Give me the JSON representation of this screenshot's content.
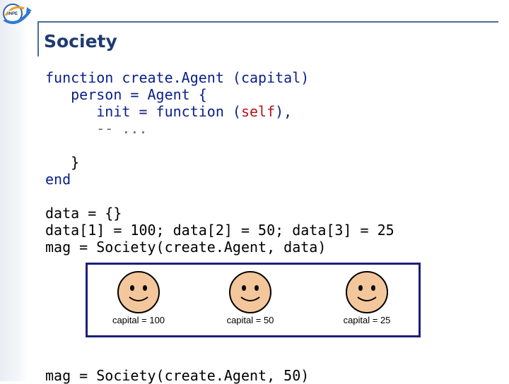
{
  "slide": {
    "title": "Society",
    "code_lines": {
      "l1": "function create.Agent (capital)",
      "l2_kw": "   person = Agent {",
      "l3_a": "      init = function (",
      "l3_self": "self",
      "l3_b": "),",
      "l4": "      -- ...",
      "l5": "   }",
      "l6_kw": "end",
      "l7": "data = {}",
      "l8": "data[1] = 100; data[2] = 50; data[3] = 25",
      "l9": "mag = Society(create.Agent, data)",
      "l10": "mag = Society(create.Agent, 50)"
    },
    "agents": [
      {
        "label": "capital = 100",
        "icon": "smiley-face-icon"
      },
      {
        "label": "capital = 50",
        "icon": "smiley-face-icon"
      },
      {
        "label": "capital = 25",
        "icon": "smiley-face-icon"
      }
    ],
    "colors": {
      "title": "#1f3a6e",
      "keyword": "#0a1f8a",
      "self": "#b0141a",
      "box_border": "#1b1f7a",
      "face_fill": "#f3c79b"
    }
  }
}
